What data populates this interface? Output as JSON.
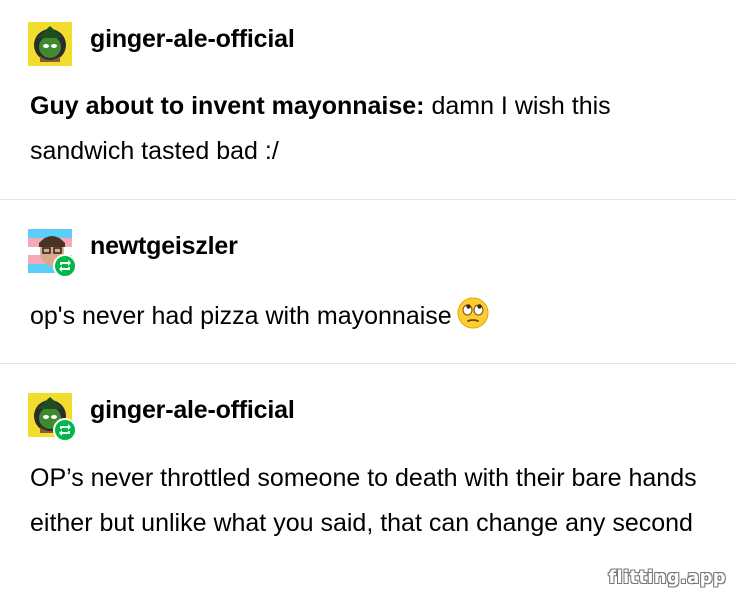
{
  "posts": [
    {
      "username": "ginger-ale-official",
      "reblog": false,
      "avatar_icon": "pepe-wizard-avatar-icon",
      "text_bold": "Guy about to invent mayonnaise:",
      "text": " damn I wish this sandwich tasted bad :/"
    },
    {
      "username": "newtgeiszler",
      "reblog": true,
      "avatar_icon": "trans-flag-avatar-icon",
      "text": "op's never had pizza with mayonnaise",
      "emoji": "eye-roll-emoji-icon"
    },
    {
      "username": "ginger-ale-official",
      "reblog": true,
      "avatar_icon": "pepe-wizard-avatar-icon",
      "text": "OP’s never throttled someone to death with their bare hands either but unlike what you said, that can change any second"
    }
  ],
  "watermark": "flitting.app",
  "colors": {
    "reblog_badge": "#00b84a",
    "divider": "#e4e4e4",
    "emoji_face": "#ffcc33",
    "avatar_yellow": "#f1dd2e"
  }
}
